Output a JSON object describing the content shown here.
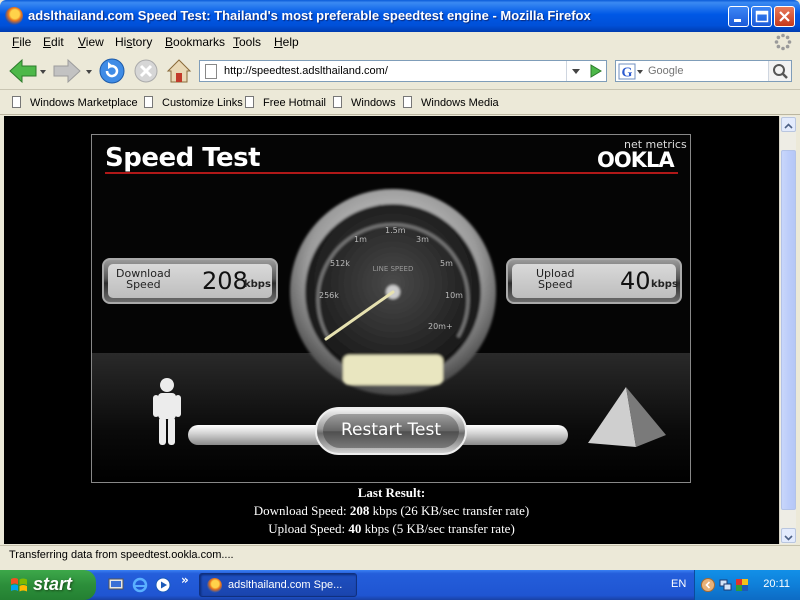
{
  "window": {
    "title": "adslthailand.com Speed Test: Thailand's most preferable speedtest engine - Mozilla Firefox"
  },
  "menu": {
    "items": [
      {
        "label": "File",
        "key": "F"
      },
      {
        "label": "Edit",
        "key": "E"
      },
      {
        "label": "View",
        "key": "V"
      },
      {
        "label": "History",
        "key": "s"
      },
      {
        "label": "Bookmarks",
        "key": "B"
      },
      {
        "label": "Tools",
        "key": "T"
      },
      {
        "label": "Help",
        "key": "H"
      }
    ]
  },
  "nav": {
    "url": "http://speedtest.adslthailand.com/",
    "search_placeholder": "Google",
    "search_engine": "G"
  },
  "bookmarks": {
    "items": [
      "Windows Marketplace",
      "Customize Links",
      "Free Hotmail",
      "Windows",
      "Windows Media"
    ]
  },
  "speedtest": {
    "title": "Speed Test",
    "brand_small": "net metrics",
    "brand": "OOKLA",
    "download": {
      "label_line1": "Download",
      "label_line2": "Speed",
      "value": "208",
      "unit": "kbps"
    },
    "upload": {
      "label_line1": "Upload",
      "label_line2": "Speed",
      "value": "40",
      "unit": "kbps"
    },
    "gauge": {
      "label": "LINE SPEED",
      "ticks": [
        "256k",
        "512k",
        "1m",
        "1.5m",
        "3m",
        "5m",
        "10m",
        "20m+"
      ]
    },
    "restart_label": "Restart Test"
  },
  "last_result": {
    "title": "Last Result:",
    "download_prefix": "Download Speed: ",
    "download_value": "208",
    "download_suffix": " kbps (26 KB/sec transfer rate)",
    "upload_prefix": "Upload Speed: ",
    "upload_value": "40",
    "upload_suffix": " kbps (5 KB/sec transfer rate)"
  },
  "status": {
    "text": "Transferring data from speedtest.ookla.com...."
  },
  "taskbar": {
    "start_label": "start",
    "more": "»",
    "task_label": "adslthailand.com Spe...",
    "language": "EN",
    "clock": "20:11"
  },
  "colors": {
    "accent_red": "#b01818",
    "xp_blue": "#0058e6",
    "start_green": "#2c8e3a"
  }
}
